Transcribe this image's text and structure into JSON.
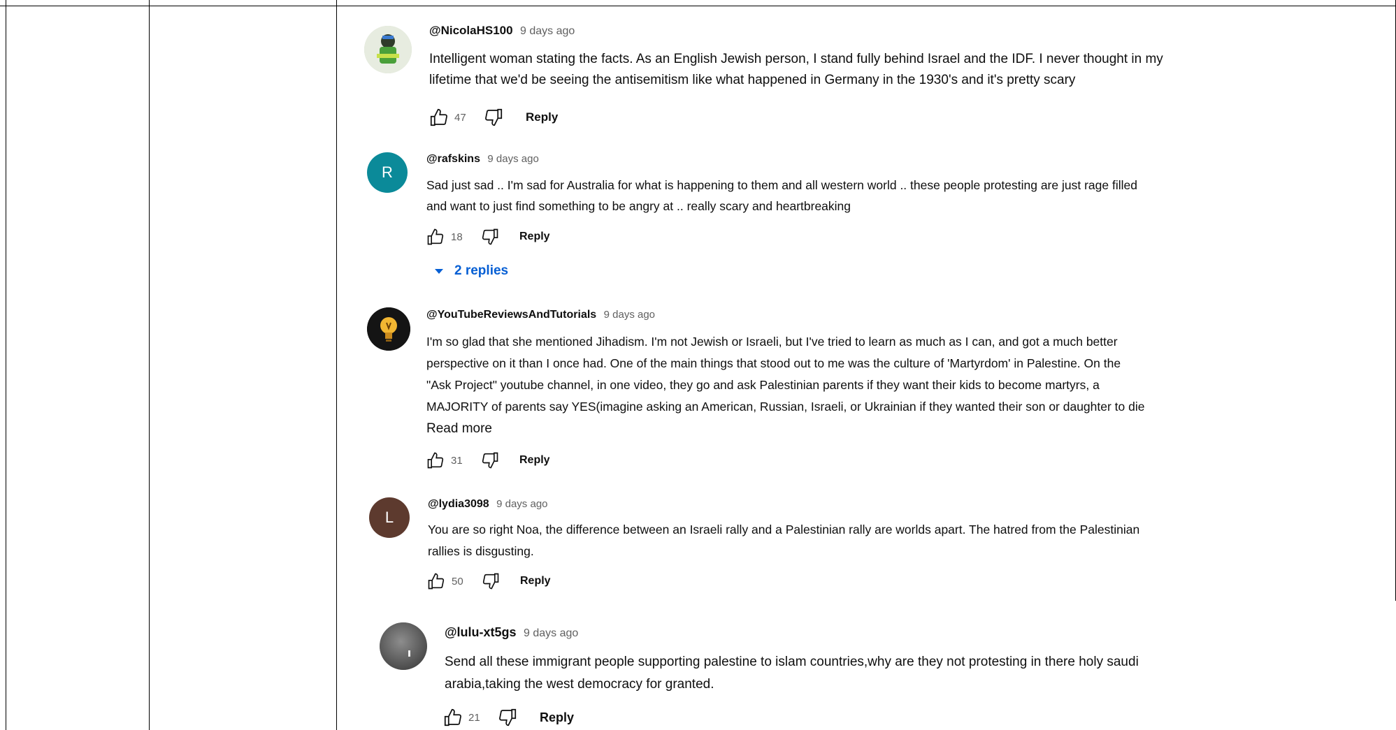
{
  "comments": [
    {
      "author": "@NicolaHS100",
      "time": "9 days ago",
      "text_lines": [
        "Intelligent woman stating the facts. As an English Jewish person, I stand fully behind Israel and the IDF. I never thought in my",
        "lifetime that we'd be seeing the antisemitism like what happened in Germany in the 1930's and it's pretty scary"
      ],
      "likes": "47",
      "reply_label": "Reply"
    },
    {
      "author": "@rafskins",
      "time": "9 days ago",
      "avatar_letter": "R",
      "avatar_color": "#0b8a99",
      "text_lines": [
        "Sad just sad .. I'm sad for Australia for what is happening to them and all western world .. these people protesting are just rage filled",
        "and want to just find something to be angry at .. really scary and heartbreaking"
      ],
      "likes": "18",
      "reply_label": "Reply",
      "replies_label": "2 replies"
    },
    {
      "author": "@YouTubeReviewsAndTutorials",
      "time": "9 days ago",
      "text_lines": [
        "I'm so glad that she mentioned Jihadism. I'm not Jewish or Israeli, but I've tried to learn as much as I can, and got a much better",
        "perspective on it than I once had. One of the main things that stood out to me was the culture of 'Martyrdom' in Palestine. On the",
        "\"Ask Project\" youtube channel, in one video, they go and ask Palestinian parents if they want their kids to become martyrs, a",
        "MAJORITY of parents say YES(imagine asking an American, Russian, Israeli, or Ukrainian if they wanted their son or daughter to die"
      ],
      "read_more": "Read more",
      "likes": "31",
      "reply_label": "Reply"
    },
    {
      "author": "@lydia3098",
      "time": "9 days ago",
      "avatar_letter": "L",
      "avatar_color": "#5d3a2e",
      "text_lines": [
        "You are so right Noa, the difference between an Israeli rally and a Palestinian rally are worlds apart. The hatred from the Palestinian",
        "rallies is disgusting."
      ],
      "likes": "50",
      "reply_label": "Reply"
    },
    {
      "author": "@lulu-xt5gs",
      "time": "9 days ago",
      "text_lines": [
        "Send all these  immigrant people supporting palestine to islam countries,why are they not protesting in there holy saudi",
        "arabia,taking the west democracy for granted."
      ],
      "likes": "21",
      "reply_label": "Reply"
    }
  ]
}
